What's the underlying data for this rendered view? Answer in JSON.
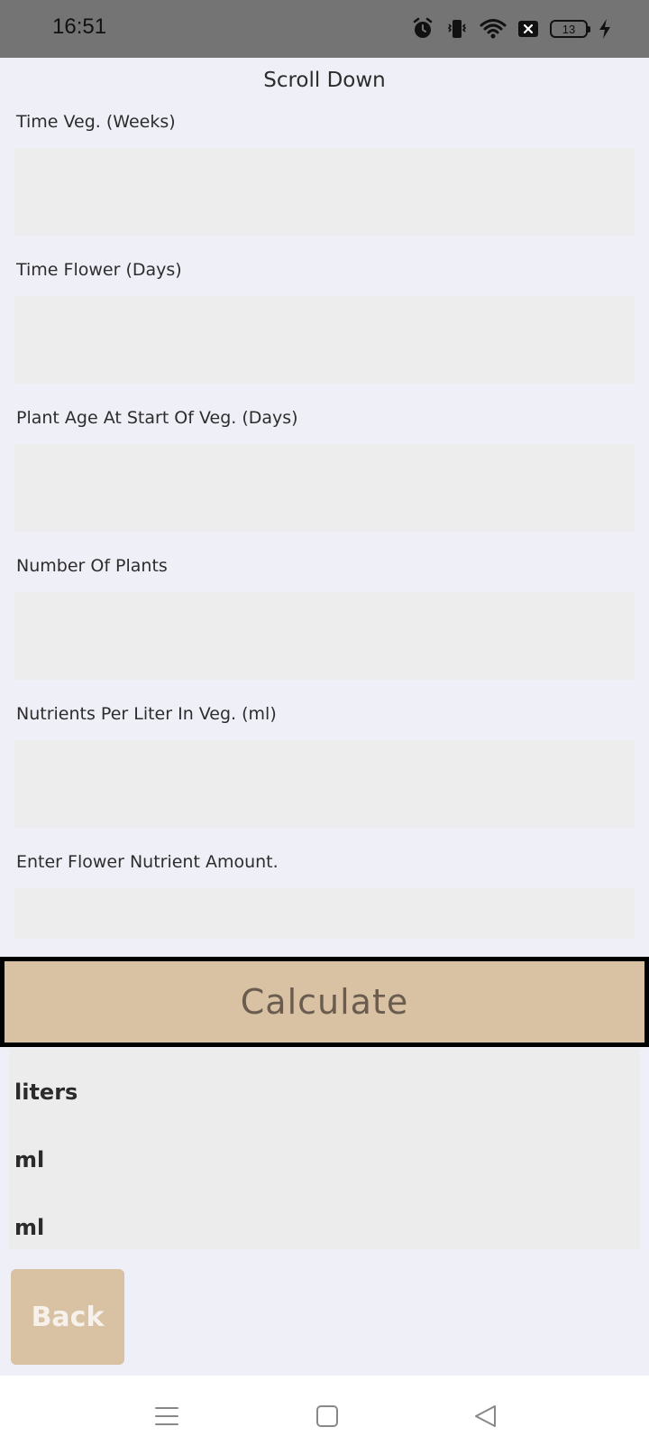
{
  "status_bar": {
    "time": "16:51",
    "battery_level": "13",
    "icons": [
      "alarm-icon",
      "vibrate-icon",
      "wifi-icon",
      "close-box-icon",
      "battery-icon",
      "charging-icon"
    ]
  },
  "header": {
    "scroll_hint": "Scroll Down"
  },
  "form": {
    "fields": [
      {
        "label": "Time Veg. (Weeks)",
        "value": ""
      },
      {
        "label": "Time Flower (Days)",
        "value": ""
      },
      {
        "label": "Plant Age At Start Of Veg. (Days)",
        "value": ""
      },
      {
        "label": "Number Of Plants",
        "value": ""
      },
      {
        "label": "Nutrients Per Liter In Veg. (ml)",
        "value": ""
      },
      {
        "label": "Enter Flower Nutrient Amount.",
        "value": ""
      }
    ],
    "calculate_label": "Calculate"
  },
  "results": {
    "lines": [
      "liters",
      "ml",
      "ml"
    ]
  },
  "back_label": "Back",
  "colors": {
    "status_bar": "#747474",
    "background": "#efeff8",
    "input_fill": "#ededed",
    "button_tan": "#d9c1a3",
    "calc_text": "#6a5c4e"
  }
}
